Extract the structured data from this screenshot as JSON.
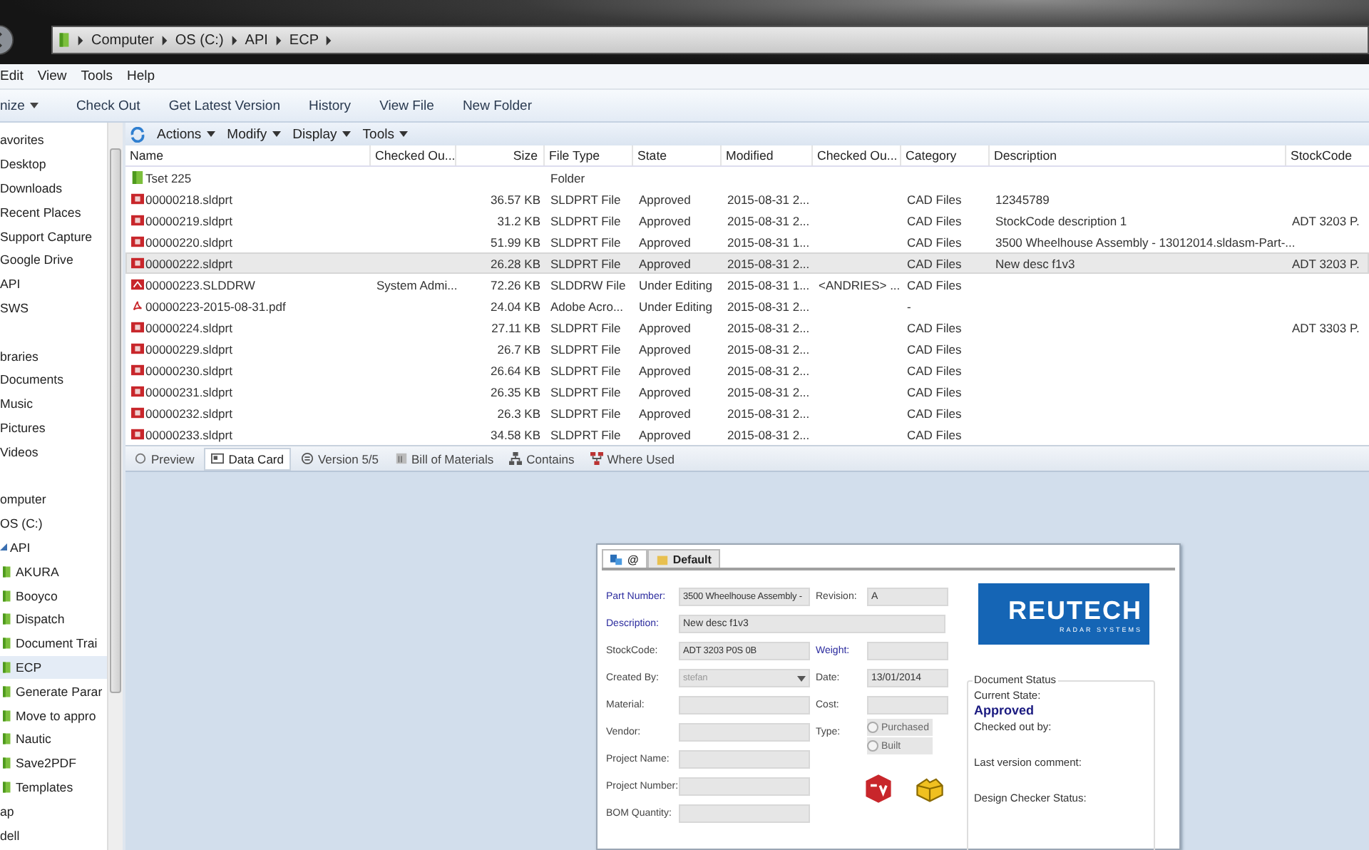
{
  "address_bar": {
    "breadcrumbs": [
      "Computer",
      "OS (C:)",
      "API",
      "ECP"
    ]
  },
  "menu": [
    "Edit",
    "View",
    "Tools",
    "Help"
  ],
  "commands": [
    {
      "label": "nize",
      "dropdown": true
    },
    {
      "label": "Check Out",
      "dropdown": false
    },
    {
      "label": "Get Latest Version",
      "dropdown": false
    },
    {
      "label": "History",
      "dropdown": false
    },
    {
      "label": "View File",
      "dropdown": false
    },
    {
      "label": "New Folder",
      "dropdown": false
    }
  ],
  "sidebar": {
    "sections": [
      {
        "label": "avorites",
        "children": [
          {
            "label": "Desktop"
          },
          {
            "label": "Downloads"
          },
          {
            "label": "Recent Places"
          },
          {
            "label": "Support Capture"
          },
          {
            "label": "Google Drive"
          },
          {
            "label": "API"
          },
          {
            "label": "SWS"
          }
        ]
      },
      {
        "label": "braries",
        "children": [
          {
            "label": "Documents"
          },
          {
            "label": "Music"
          },
          {
            "label": "Pictures"
          },
          {
            "label": "Videos"
          }
        ]
      },
      {
        "label": "omputer",
        "children": [
          {
            "label": "OS (C:)",
            "children": [
              {
                "label": "API",
                "expanded": true,
                "children": [
                  {
                    "label": "AKURA",
                    "selected": false
                  },
                  {
                    "label": "Booyco",
                    "selected": false
                  },
                  {
                    "label": "Dispatch",
                    "selected": false
                  },
                  {
                    "label": "Document Trai",
                    "selected": false
                  },
                  {
                    "label": "ECP",
                    "selected": true
                  },
                  {
                    "label": "Generate Parar",
                    "selected": false
                  },
                  {
                    "label": "Move to appro",
                    "selected": false
                  },
                  {
                    "label": "Nautic",
                    "selected": false
                  },
                  {
                    "label": "Save2PDF",
                    "selected": false
                  },
                  {
                    "label": "Templates",
                    "selected": false
                  }
                ]
              },
              {
                "label": "ap"
              },
              {
                "label": "dell"
              }
            ]
          }
        ]
      }
    ]
  },
  "vault_toolbar": [
    "Actions",
    "Modify",
    "Display",
    "Tools"
  ],
  "file_list": {
    "columns": [
      "Name",
      "Checked Ou...",
      "Size",
      "File Type",
      "State",
      "Modified",
      "Checked Ou...",
      "Category",
      "Description",
      "StockCode"
    ],
    "rows": [
      {
        "kind": "folder",
        "selected": false,
        "cells": [
          "Tset 225",
          null,
          null,
          "Folder",
          null,
          null,
          null,
          null,
          null,
          null
        ]
      },
      {
        "kind": "part",
        "selected": false,
        "cells": [
          "00000218.sldprt",
          null,
          "36.57 KB",
          "SLDPRT File",
          "Approved",
          "2015-08-31 2...",
          null,
          "CAD Files",
          "12345789",
          null
        ]
      },
      {
        "kind": "part",
        "selected": false,
        "cells": [
          "00000219.sldprt",
          null,
          "31.2 KB",
          "SLDPRT File",
          "Approved",
          "2015-08-31 2...",
          null,
          "CAD Files",
          "StockCode description 1",
          "ADT 3203 P."
        ]
      },
      {
        "kind": "part",
        "selected": false,
        "cells": [
          "00000220.sldprt",
          null,
          "51.99 KB",
          "SLDPRT File",
          "Approved",
          "2015-08-31 1...",
          null,
          "CAD Files",
          "3500 Wheelhouse Assembly - 13012014.sldasm-Part-...",
          null
        ]
      },
      {
        "kind": "part",
        "selected": true,
        "cells": [
          "00000222.sldprt",
          null,
          "26.28 KB",
          "SLDPRT File",
          "Approved",
          "2015-08-31 2...",
          null,
          "CAD Files",
          "New desc f1v3",
          "ADT 3203 P."
        ]
      },
      {
        "kind": "drawing",
        "selected": false,
        "cells": [
          "00000223.SLDDRW",
          "System Admi...",
          "72.26 KB",
          "SLDDRW File",
          "Under Editing",
          "2015-08-31 1...",
          "<ANDRIES> ...",
          "CAD Files",
          null,
          null
        ]
      },
      {
        "kind": "pdf",
        "selected": false,
        "cells": [
          "00000223-2015-08-31.pdf",
          null,
          "24.04 KB",
          "Adobe Acro...",
          "Under Editing",
          "2015-08-31 2...",
          null,
          "-",
          null,
          null
        ]
      },
      {
        "kind": "part",
        "selected": false,
        "cells": [
          "00000224.sldprt",
          null,
          "27.11 KB",
          "SLDPRT File",
          "Approved",
          "2015-08-31 2...",
          null,
          "CAD Files",
          null,
          "ADT 3303 P."
        ]
      },
      {
        "kind": "part",
        "selected": false,
        "cells": [
          "00000229.sldprt",
          null,
          "26.7 KB",
          "SLDPRT File",
          "Approved",
          "2015-08-31 2...",
          null,
          "CAD Files",
          null,
          null
        ]
      },
      {
        "kind": "part",
        "selected": false,
        "cells": [
          "00000230.sldprt",
          null,
          "26.64 KB",
          "SLDPRT File",
          "Approved",
          "2015-08-31 2...",
          null,
          "CAD Files",
          null,
          null
        ]
      },
      {
        "kind": "part",
        "selected": false,
        "cells": [
          "00000231.sldprt",
          null,
          "26.35 KB",
          "SLDPRT File",
          "Approved",
          "2015-08-31 2...",
          null,
          "CAD Files",
          null,
          null
        ]
      },
      {
        "kind": "part",
        "selected": false,
        "cells": [
          "00000232.sldprt",
          null,
          "26.3 KB",
          "SLDPRT File",
          "Approved",
          "2015-08-31 2...",
          null,
          "CAD Files",
          null,
          null
        ]
      },
      {
        "kind": "part",
        "selected": false,
        "cells": [
          "00000233.sldprt",
          null,
          "34.58 KB",
          "SLDPRT File",
          "Approved",
          "2015-08-31 2...",
          null,
          "CAD Files",
          null,
          null
        ]
      }
    ]
  },
  "bottom_tabs": [
    {
      "kind": "preview",
      "label": "Preview",
      "selected": false
    },
    {
      "kind": "card",
      "label": "Data Card",
      "selected": true
    },
    {
      "kind": "version",
      "label": "Version 5/5",
      "selected": false
    },
    {
      "kind": "bom",
      "label": "Bill of Materials",
      "selected": false
    },
    {
      "kind": "contains",
      "label": "Contains",
      "selected": false
    },
    {
      "kind": "where",
      "label": "Where Used",
      "selected": false
    }
  ],
  "data_card": {
    "tabs": [
      {
        "label": "@",
        "selected": true
      },
      {
        "label": "Default",
        "selected": false
      }
    ],
    "rows": [
      [
        {
          "label": "Part Number:",
          "value": "3500 Wheelhouse Assembly -",
          "required": true
        },
        {
          "label": "Revision:",
          "value": "A",
          "required": false
        }
      ],
      [
        {
          "label": "Description:",
          "value": "New desc f1v3",
          "required": true,
          "kind": "wide"
        }
      ],
      [
        {
          "label": "StockCode:",
          "value": "ADT  3203  P0S  0B",
          "required": false
        },
        {
          "label": "Weight:",
          "required": true
        }
      ],
      [
        {
          "label": "Created By:",
          "value": "stefan",
          "required": false,
          "kind": "dropdown",
          "disabled": true
        },
        {
          "label": "Date:",
          "value": "13/01/2014",
          "required": false
        }
      ],
      [
        {
          "label": "Material:",
          "required": false
        },
        {
          "label": "Cost:",
          "required": false
        }
      ],
      [
        {
          "label": "Vendor:",
          "required": false
        },
        {
          "label": "Type:",
          "required": false,
          "kind": "radio",
          "options": [
            {
              "label": "Purchased",
              "selected": false
            },
            {
              "label": "Built",
              "selected": false
            }
          ]
        }
      ],
      [
        {
          "label": "Project Name:",
          "required": false
        }
      ],
      [
        {
          "label": "Project Number:",
          "required": false
        }
      ],
      [
        {
          "label": "BOM Quantity:",
          "required": false
        }
      ]
    ],
    "logo": {
      "name": "REUTECH",
      "tagline": "RADAR SYSTEMS"
    },
    "document_status": {
      "title": "Document Status",
      "items": [
        {
          "label": "Current State:",
          "value": "Approved"
        },
        {
          "label": "Checked out by:"
        },
        {
          "label": "Last version comment:"
        },
        {
          "label": "Design Checker Status:"
        }
      ]
    }
  }
}
